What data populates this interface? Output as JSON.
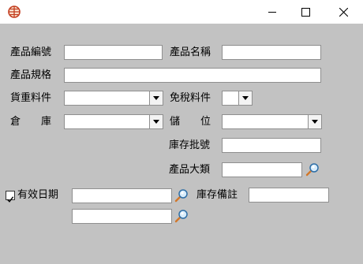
{
  "window": {
    "icon": "globe-icon",
    "minimize": "minimize-icon",
    "maximize": "maximize-icon",
    "close": "close-icon"
  },
  "form": {
    "product_code_label": "產品編號",
    "product_code_value": "",
    "product_name_label": "產品名稱",
    "product_name_value": "",
    "product_spec_label": "產品規格",
    "product_spec_value": "",
    "cost_item_label": "貨重料件",
    "cost_item_value": "",
    "tax_exempt_label": "免稅料件",
    "tax_exempt_value": "",
    "warehouse_label": "倉　　庫",
    "warehouse_value": "",
    "location_label": "儲　　位",
    "location_value": "",
    "batch_no_label": "庫存批號",
    "batch_no_value": "",
    "category_label": "產品大類",
    "category_value": "",
    "expiry_checkbox_label": "有效日期",
    "expiry_checked": true,
    "expiry_from_value": "",
    "expiry_to_value": "",
    "stock_note_label": "庫存備註",
    "stock_note_value": ""
  }
}
